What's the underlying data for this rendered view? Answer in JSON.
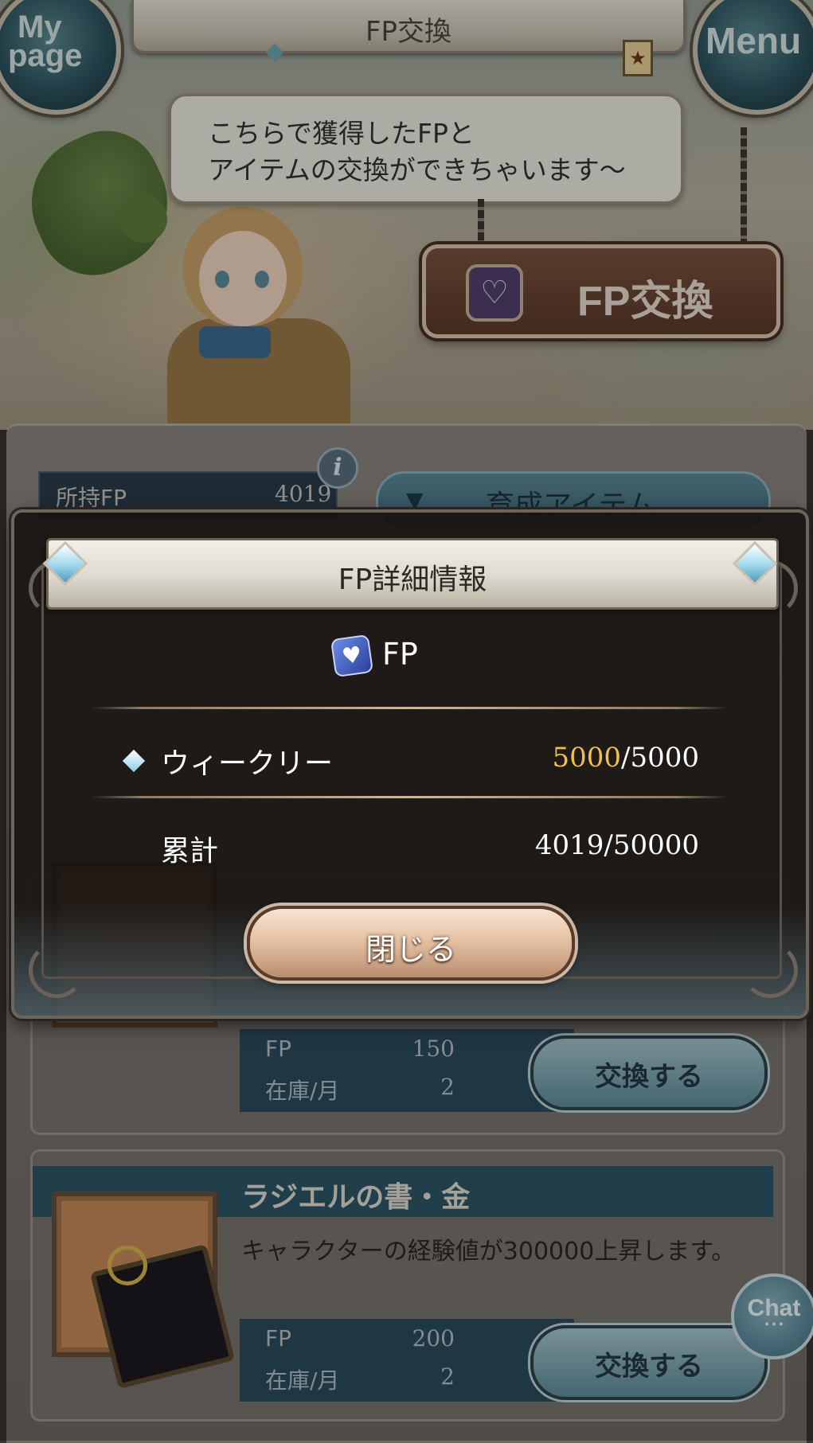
{
  "header": {
    "mypage_line1": "My",
    "mypage_line2": "page",
    "title": "FP交換",
    "menu_label": "Menu"
  },
  "scene": {
    "speech_line1": "こちらで獲得したFPと",
    "speech_line2": "アイテムの交換ができちゃいます～",
    "sign_label": "FP交換"
  },
  "summary": {
    "owned_label": "所持FP",
    "owned_value": "4019",
    "category": "育成アイテム"
  },
  "items": [
    {
      "fp_label": "FP",
      "fp_value": "150",
      "stock_label": "在庫/月",
      "stock_value": "2",
      "button": "交換する"
    },
    {
      "name": "ラジエルの書・金",
      "description": "キャラクターの経験値が300000上昇します。",
      "fp_label": "FP",
      "fp_value": "200",
      "stock_label": "在庫/月",
      "stock_value": "2",
      "button": "交換する"
    }
  ],
  "modal": {
    "title": "FP詳細情報",
    "currency_label": "FP",
    "weekly_label": "ウィークリー",
    "weekly_current": "5000",
    "weekly_max": "/5000",
    "total_label": "累計",
    "total_value": "4019/50000",
    "close_label": "閉じる"
  },
  "chat": {
    "label": "Chat"
  },
  "colors": {
    "highlight": "#f0c049",
    "title_bar_blue": "#2d5868",
    "panel": "#7a7570"
  },
  "icons": [
    "info-icon",
    "chevron-down-icon",
    "fp-gem-icon",
    "diamond-gem-icon",
    "book-icon",
    "chat-icon"
  ]
}
